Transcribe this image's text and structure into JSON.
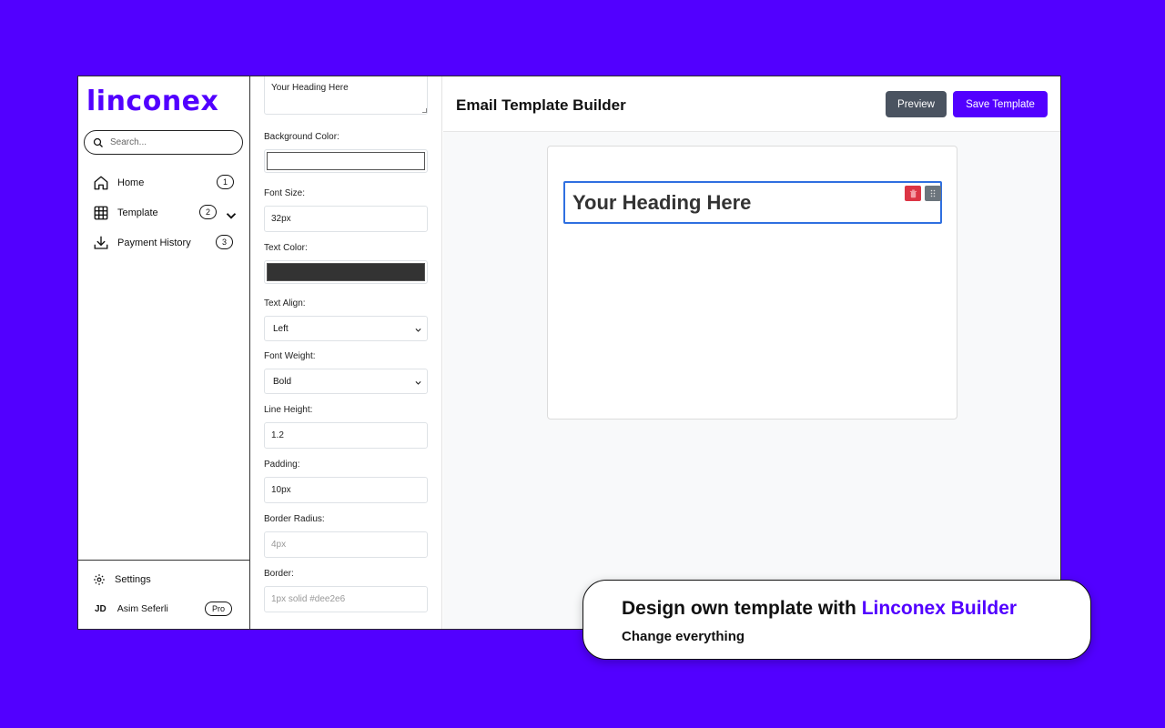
{
  "colors": {
    "brand": "#5200ff",
    "preview_button": "#4a5360",
    "selection": "#2f6fe0",
    "delete": "#dc3545",
    "drag": "#6c757d",
    "text_color_value": "#333333"
  },
  "sidebar": {
    "logo": "linconex",
    "search_placeholder": "Search...",
    "items": [
      {
        "label": "Home",
        "badge": "1",
        "icon": "home-icon"
      },
      {
        "label": "Template",
        "badge": "2",
        "icon": "grid-icon",
        "has_chevron": true
      },
      {
        "label": "Payment History",
        "badge": "3",
        "icon": "download-icon"
      }
    ],
    "settings_label": "Settings",
    "user": {
      "initials": "JD",
      "name": "Asim Seferli",
      "plan": "Pro"
    }
  },
  "panel": {
    "content_value": "Your Heading Here",
    "fields": {
      "background_color": {
        "label": "Background Color:"
      },
      "font_size": {
        "label": "Font Size:",
        "value": "32px"
      },
      "text_color": {
        "label": "Text Color:"
      },
      "text_align": {
        "label": "Text Align:",
        "value": "Left"
      },
      "font_weight": {
        "label": "Font Weight:",
        "value": "Bold"
      },
      "line_height": {
        "label": "Line Height:",
        "value": "1.2"
      },
      "padding": {
        "label": "Padding:",
        "value": "10px"
      },
      "border_radius": {
        "label": "Border Radius:",
        "placeholder": "4px"
      },
      "border": {
        "label": "Border:",
        "placeholder": "1px solid #dee2e6"
      }
    }
  },
  "main": {
    "title": "Email Template Builder",
    "preview_label": "Preview",
    "save_label": "Save Template",
    "heading_block_text": "Your Heading Here"
  },
  "promo": {
    "title_prefix": "Design own template with ",
    "title_accent": "Linconex Builder",
    "subtitle": "Change everything"
  }
}
